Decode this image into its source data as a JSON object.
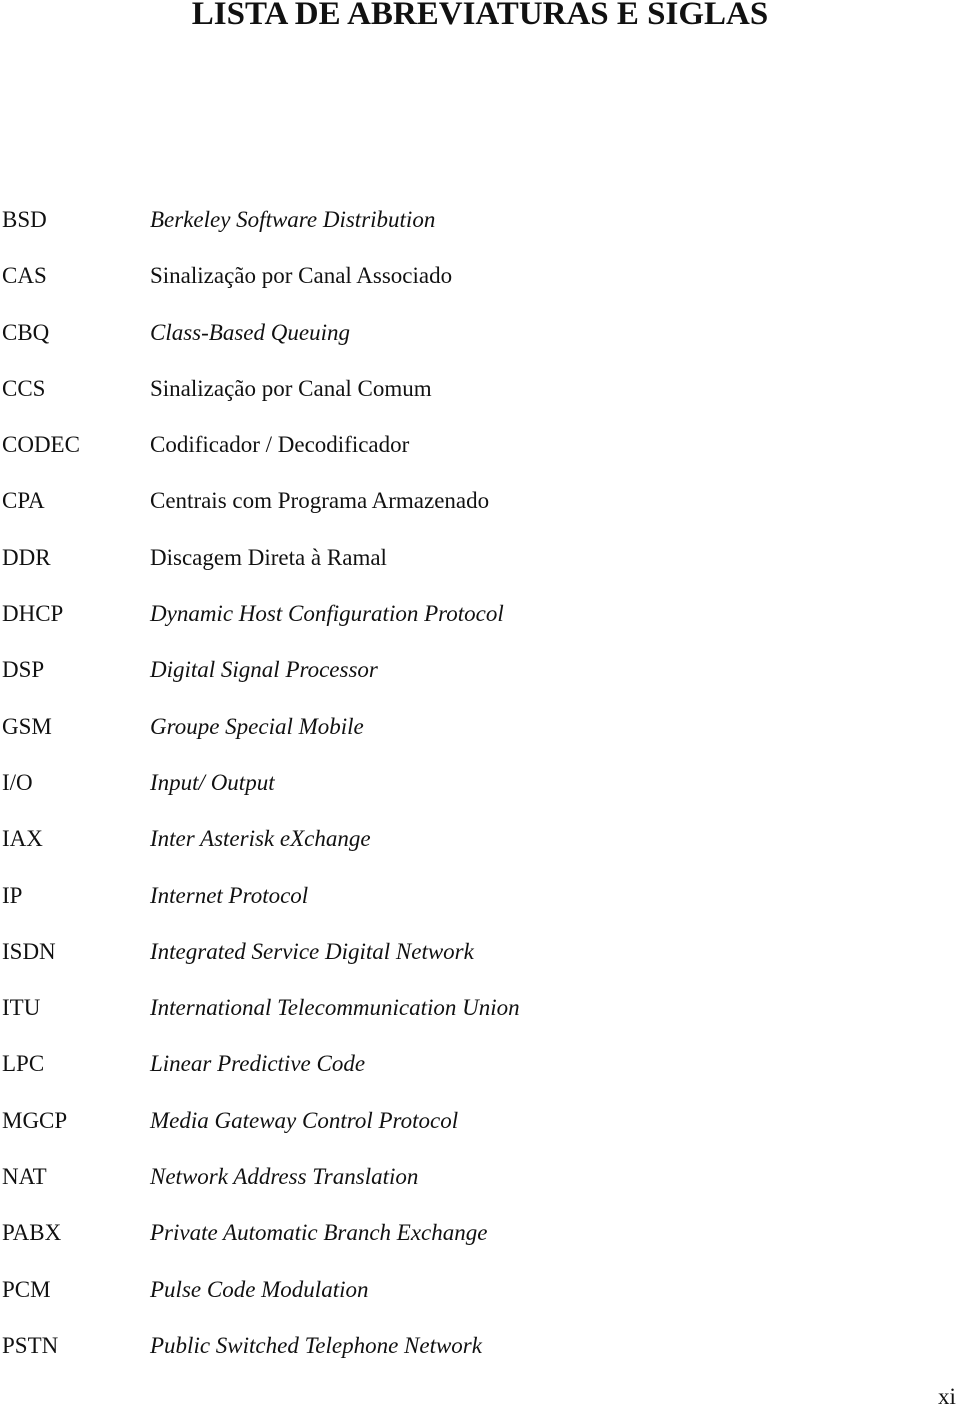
{
  "title": "LISTA DE ABREVIATURAS E SIGLAS",
  "entries": [
    {
      "abbr": "BSD",
      "def": "Berkeley Software Distribution",
      "italic": true
    },
    {
      "abbr": "CAS",
      "def": "Sinalização por Canal Associado",
      "italic": false
    },
    {
      "abbr": "CBQ",
      "def": "Class-Based Queuing",
      "italic": true
    },
    {
      "abbr": "CCS",
      "def": "Sinalização por Canal Comum",
      "italic": false
    },
    {
      "abbr": "CODEC",
      "def": "Codificador / Decodificador",
      "italic": false
    },
    {
      "abbr": "CPA",
      "def": "Centrais com Programa Armazenado",
      "italic": false
    },
    {
      "abbr": "DDR",
      "def": "Discagem Direta à Ramal",
      "italic": false
    },
    {
      "abbr": "DHCP",
      "def": "Dynamic Host Configuration Protocol",
      "italic": true
    },
    {
      "abbr": "DSP",
      "def": "Digital Signal Processor",
      "italic": true
    },
    {
      "abbr": "GSM",
      "def": "Groupe Special Mobile",
      "italic": true
    },
    {
      "abbr": "I/O",
      "def": "Input/ Output",
      "italic": true
    },
    {
      "abbr": "IAX",
      "def": "Inter Asterisk eXchange",
      "italic": true
    },
    {
      "abbr": "IP",
      "def": "Internet Protocol",
      "italic": true
    },
    {
      "abbr": "ISDN",
      "def": "Integrated Service Digital Network",
      "italic": true
    },
    {
      "abbr": "ITU",
      "def": "International Telecommunication Union",
      "italic": true
    },
    {
      "abbr": "LPC",
      "def": "Linear Predictive Code",
      "italic": true
    },
    {
      "abbr": "MGCP",
      "def": "Media Gateway Control Protocol",
      "italic": true
    },
    {
      "abbr": "NAT",
      "def": "Network Address Translation",
      "italic": true
    },
    {
      "abbr": "PABX",
      "def": "Private Automatic Branch Exchange",
      "italic": true
    },
    {
      "abbr": "PCM",
      "def": "Pulse Code Modulation",
      "italic": true
    },
    {
      "abbr": "PSTN",
      "def": "Public Switched Telephone Network",
      "italic": true
    }
  ],
  "page_number": "xi"
}
